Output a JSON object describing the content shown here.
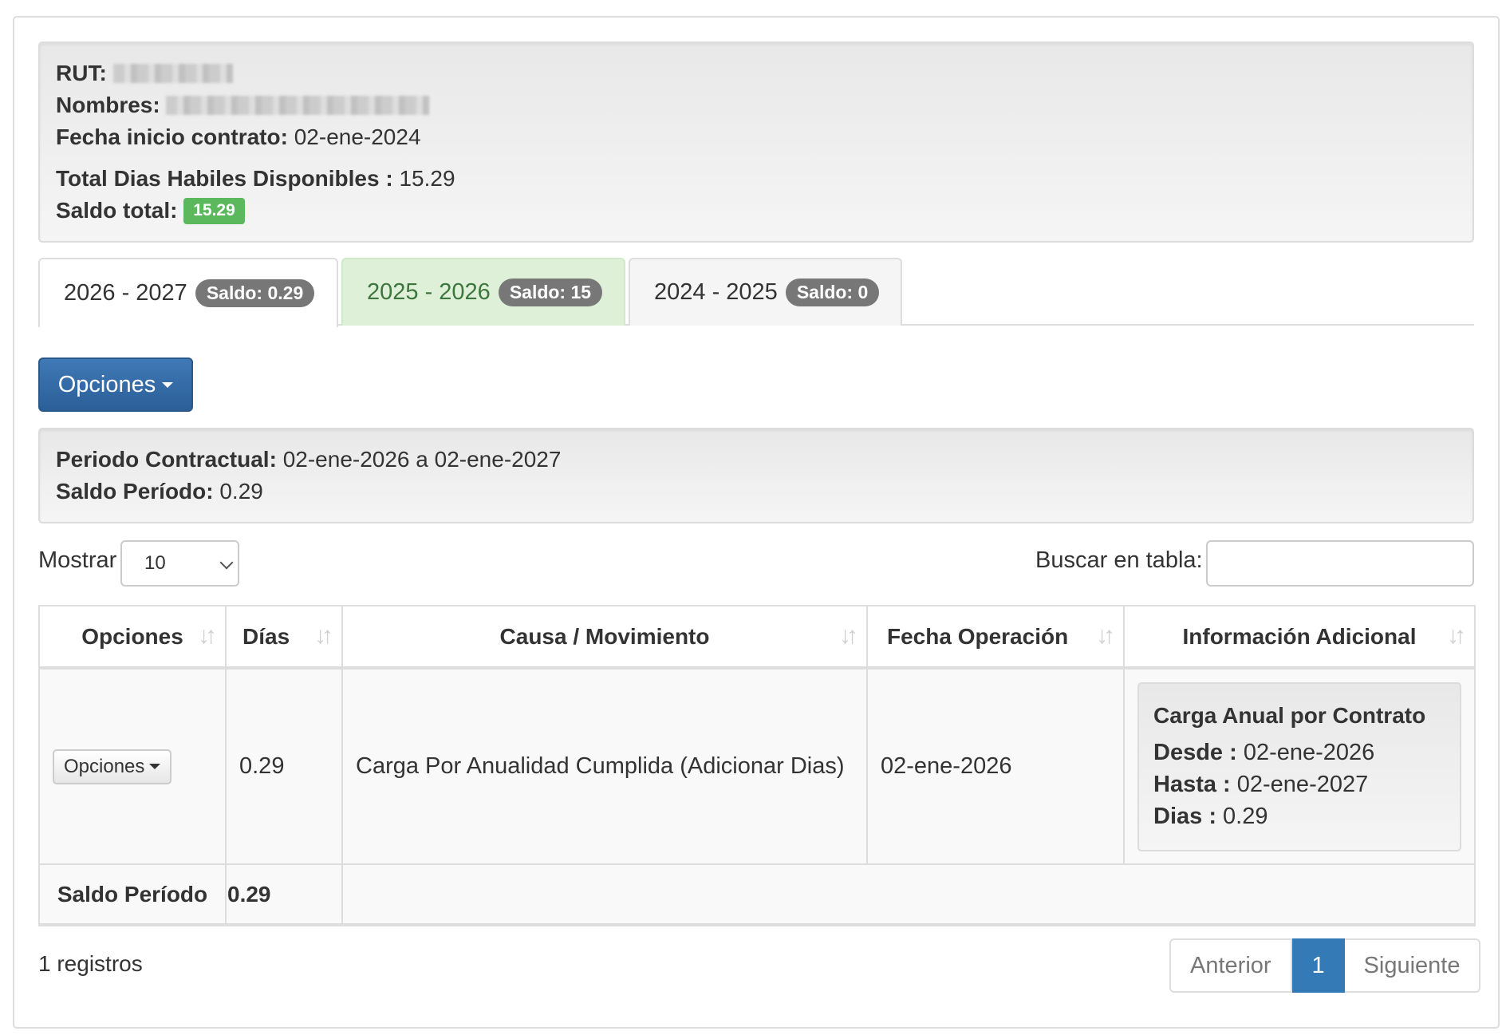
{
  "employee": {
    "rut_label": "RUT:",
    "nombres_label": "Nombres:",
    "fecha_label": "Fecha inicio contrato:",
    "fecha_value": "02-ene-2024",
    "total_label": "Total Dias Habiles Disponibles :",
    "total_value": "15.29",
    "saldo_label": "Saldo total:",
    "saldo_value": "15.29"
  },
  "tabs": [
    {
      "label": "2026 - 2027",
      "badge": "Saldo: 0.29"
    },
    {
      "label": "2025 - 2026",
      "badge": "Saldo: 15"
    },
    {
      "label": "2024 - 2025",
      "badge": "Saldo: 0"
    }
  ],
  "options_button": "Opciones",
  "period": {
    "contract_label": "Periodo Contractual:",
    "contract_value": "02-ene-2026 a 02-ene-2027",
    "saldo_label": "Saldo Período:",
    "saldo_value": "0.29"
  },
  "table_controls": {
    "show_label": "Mostrar",
    "show_value": "10",
    "search_label": "Buscar en tabla:"
  },
  "table": {
    "headers": [
      "Opciones",
      "Días",
      "Causa / Movimiento",
      "Fecha Operación",
      "Información Adicional"
    ],
    "rows": [
      {
        "options_button": "Opciones",
        "dias": "0.29",
        "causa": "Carga Por Anualidad Cumplida (Adicionar Dias)",
        "fecha": "02-ene-2026",
        "info": {
          "title": "Carga Anual por Contrato",
          "desde_label": "Desde :",
          "desde_value": "02-ene-2026",
          "hasta_label": "Hasta :",
          "hasta_value": "02-ene-2027",
          "dias_label": "Dias :",
          "dias_value": "0.29"
        }
      }
    ],
    "footer_label": "Saldo Período",
    "footer_value": "0.29"
  },
  "records_info": "1 registros",
  "pagination": {
    "prev": "Anterior",
    "current": "1",
    "next": "Siguiente"
  }
}
